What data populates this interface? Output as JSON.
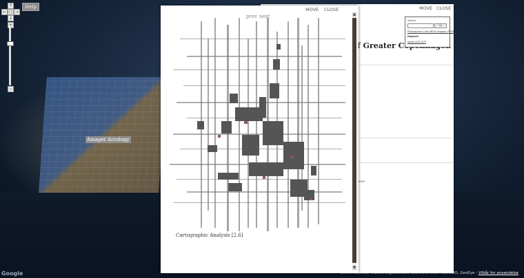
{
  "map": {
    "help_label": "Help",
    "nav_controls": {
      "up": "↑",
      "left": "←",
      "center": "○",
      "right": "→",
      "down": "↓",
      "zoom_in": "+",
      "zoom_out": "−"
    },
    "place_label": "Amager Arcology",
    "attribution": "Billedmateriale ©2009 DigitalGlobe, Scanvort, CNVI AIS, DDO, GeoEye - ",
    "terms_link": "Vilkår for anvendelse",
    "google_logo": "Google",
    "colors": {
      "sky": "#16263b",
      "topo_blue": "#3a5a8c",
      "topo_brown": "#6b5d45"
    }
  },
  "panel_left": {
    "move_label": "MOVE",
    "close_label": "CLOSE",
    "prev_label": "prev",
    "next_label": "next",
    "caption": "Cartographic Analysis [2.6]",
    "scroll_up": "▲",
    "scroll_down": "▼"
  },
  "panel_right": {
    "move_label": "MOVE",
    "close_label": "CLOSE",
    "title": "f Greater Copenhagen",
    "snippet": "asse",
    "popup": {
      "search_label": "Search",
      "go_label": "Go",
      "links": "Philosophies  Links  BIGD  Imagery  PROFIT",
      "section_label": "Rapport",
      "extra_link": "epost   LOG OUT"
    }
  }
}
